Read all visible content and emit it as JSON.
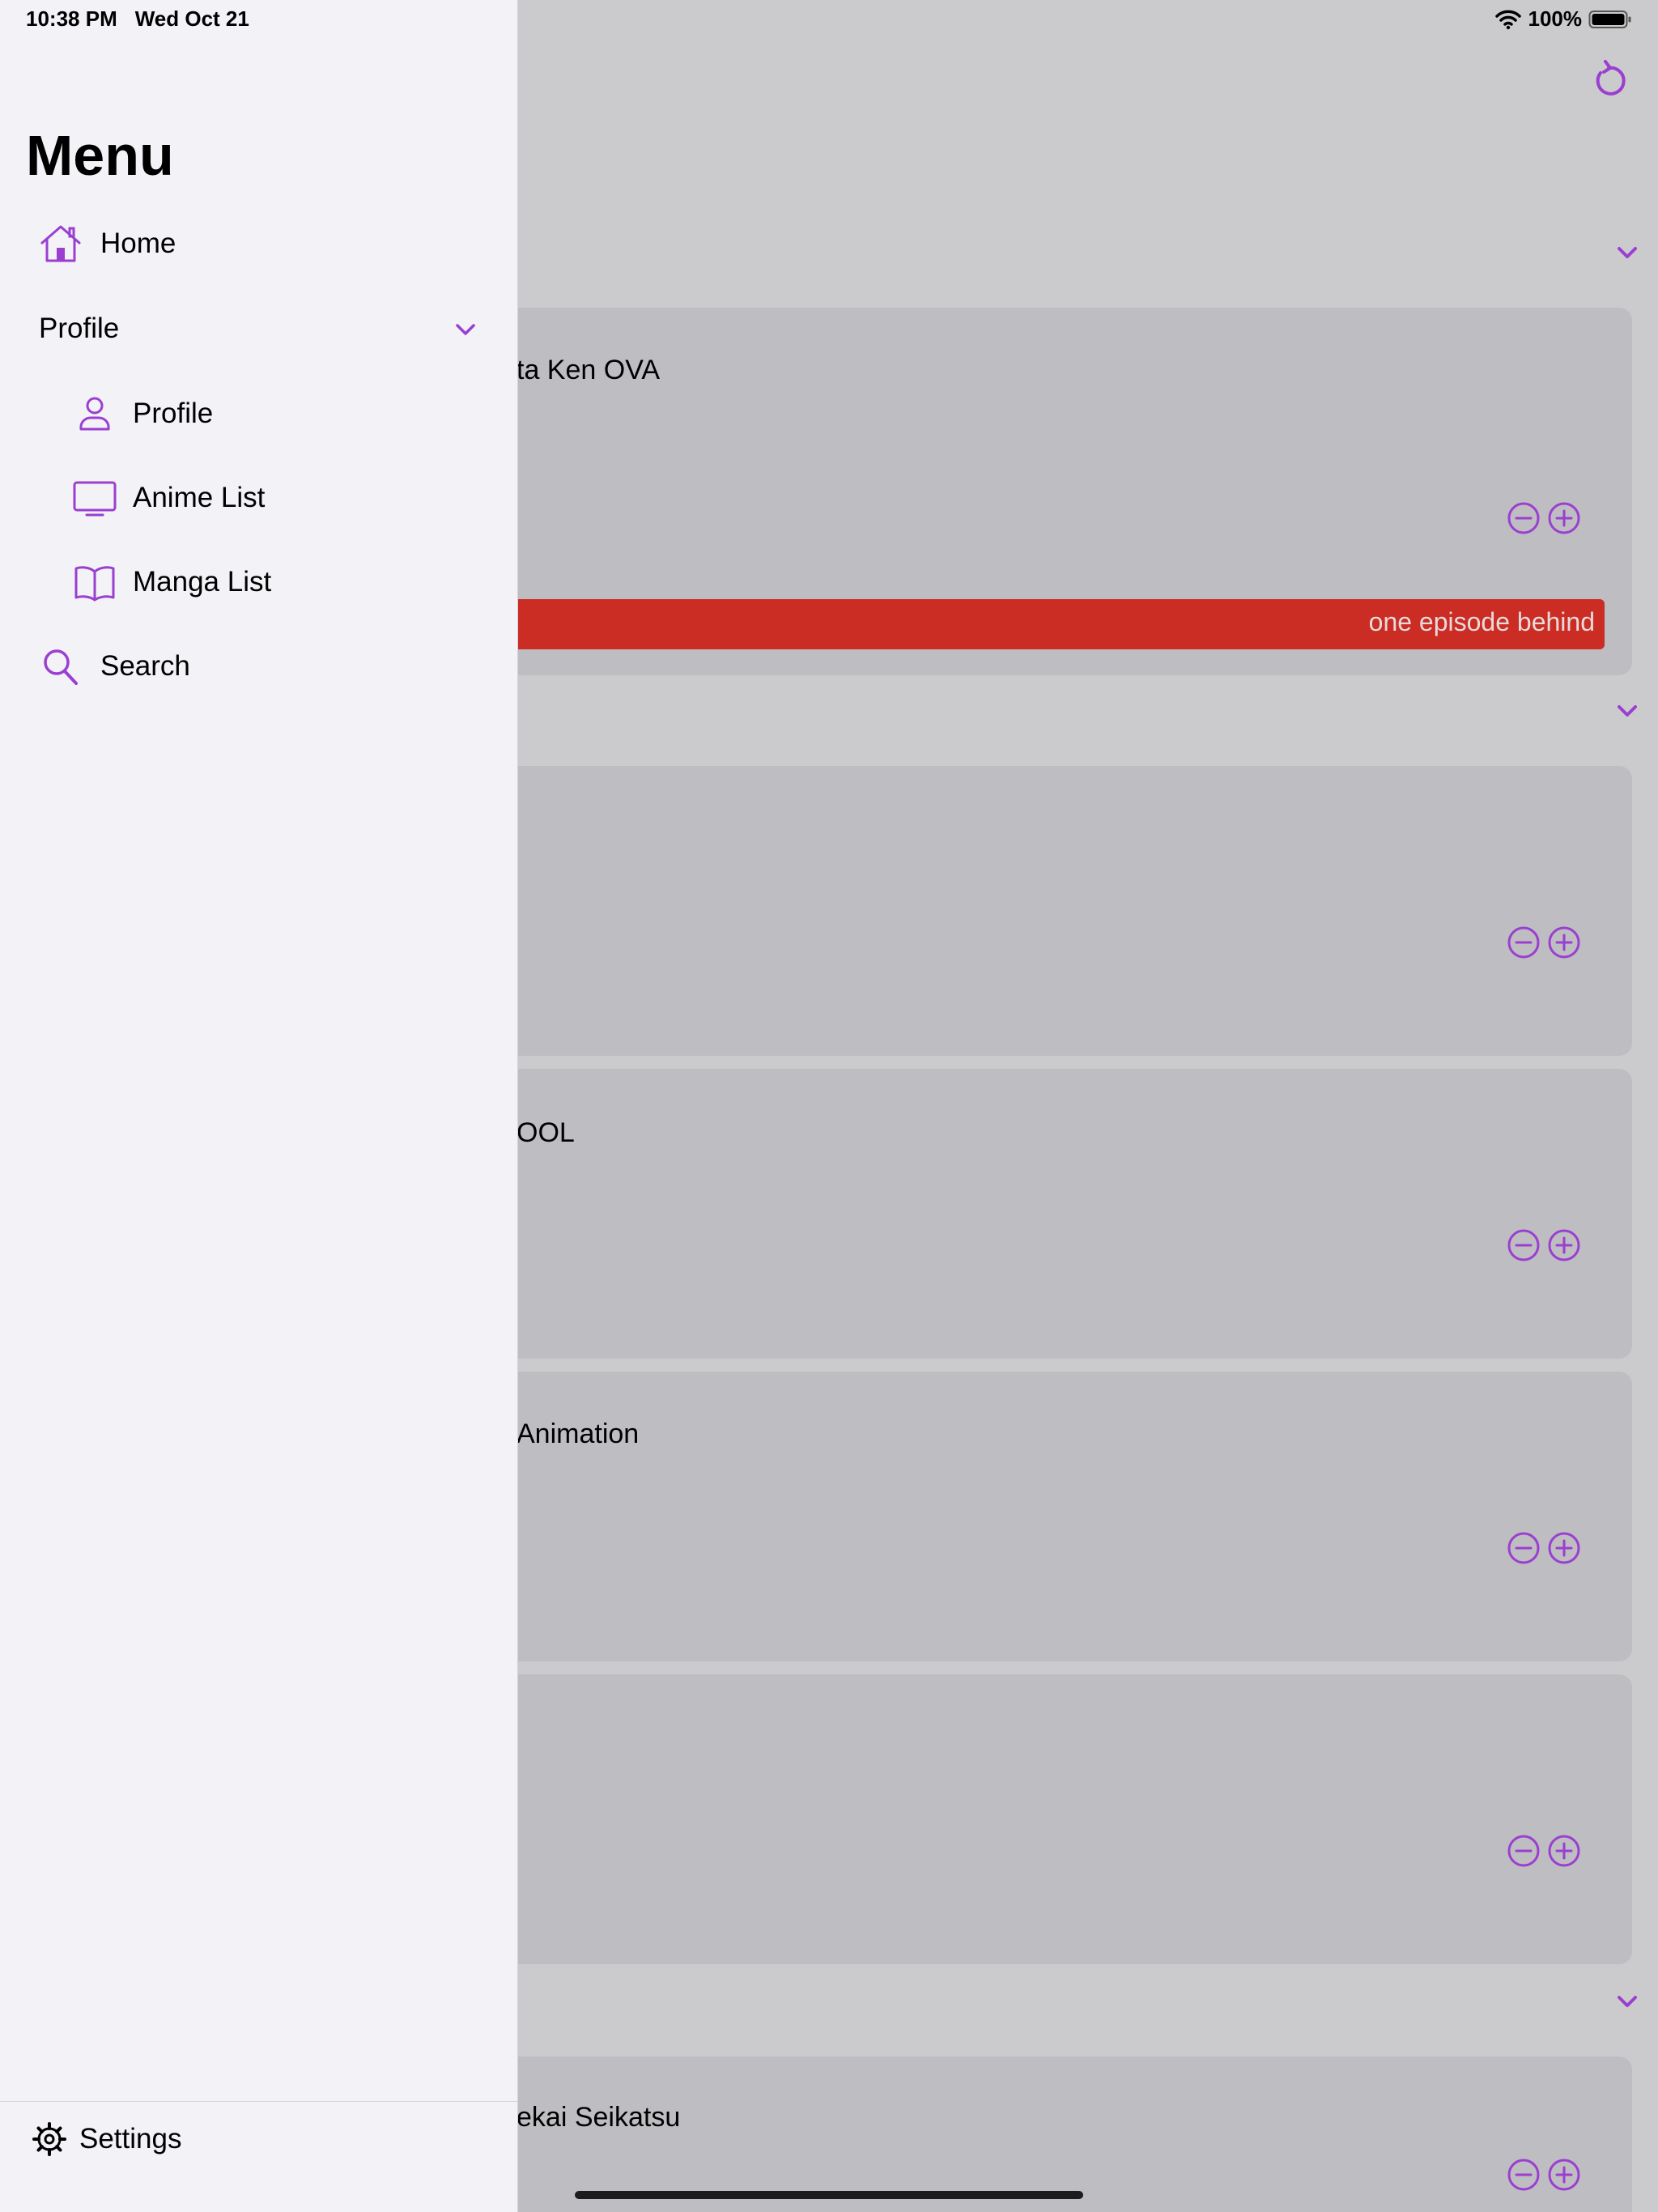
{
  "status_bar": {
    "time": "10:38 PM",
    "date": "Wed Oct 21",
    "battery": "100%",
    "wifi_icon": "wifi-icon",
    "battery_icon": "battery-icon"
  },
  "colors": {
    "accent": "#9b3fd0",
    "menu_bg": "#f2f2f7",
    "content_bg": "#cbcbcd",
    "card_bg": "#bebdc2",
    "behind_bar": "#cb2c24"
  },
  "menu": {
    "title": "Menu",
    "items": [
      {
        "label": "Home",
        "icon": "house-icon"
      },
      {
        "label": "Profile",
        "icon": "chevron-down-icon",
        "expanded": true,
        "children": [
          {
            "label": "Profile",
            "icon": "person-icon"
          },
          {
            "label": "Anime List",
            "icon": "tv-icon"
          },
          {
            "label": "Manga List",
            "icon": "book-icon"
          }
        ]
      },
      {
        "label": "Search",
        "icon": "magnifier-icon"
      }
    ],
    "settings": {
      "label": "Settings",
      "icon": "gear-icon"
    }
  },
  "content": {
    "refresh_icon": "refresh-icon",
    "cards": [
      {
        "title": "ta Ken OVA",
        "status": "one episode behind"
      },
      {
        "title": ""
      },
      {
        "title": "OOL"
      },
      {
        "title": "Animation"
      },
      {
        "title": ""
      },
      {
        "title": "ekai Seikatsu"
      }
    ]
  }
}
